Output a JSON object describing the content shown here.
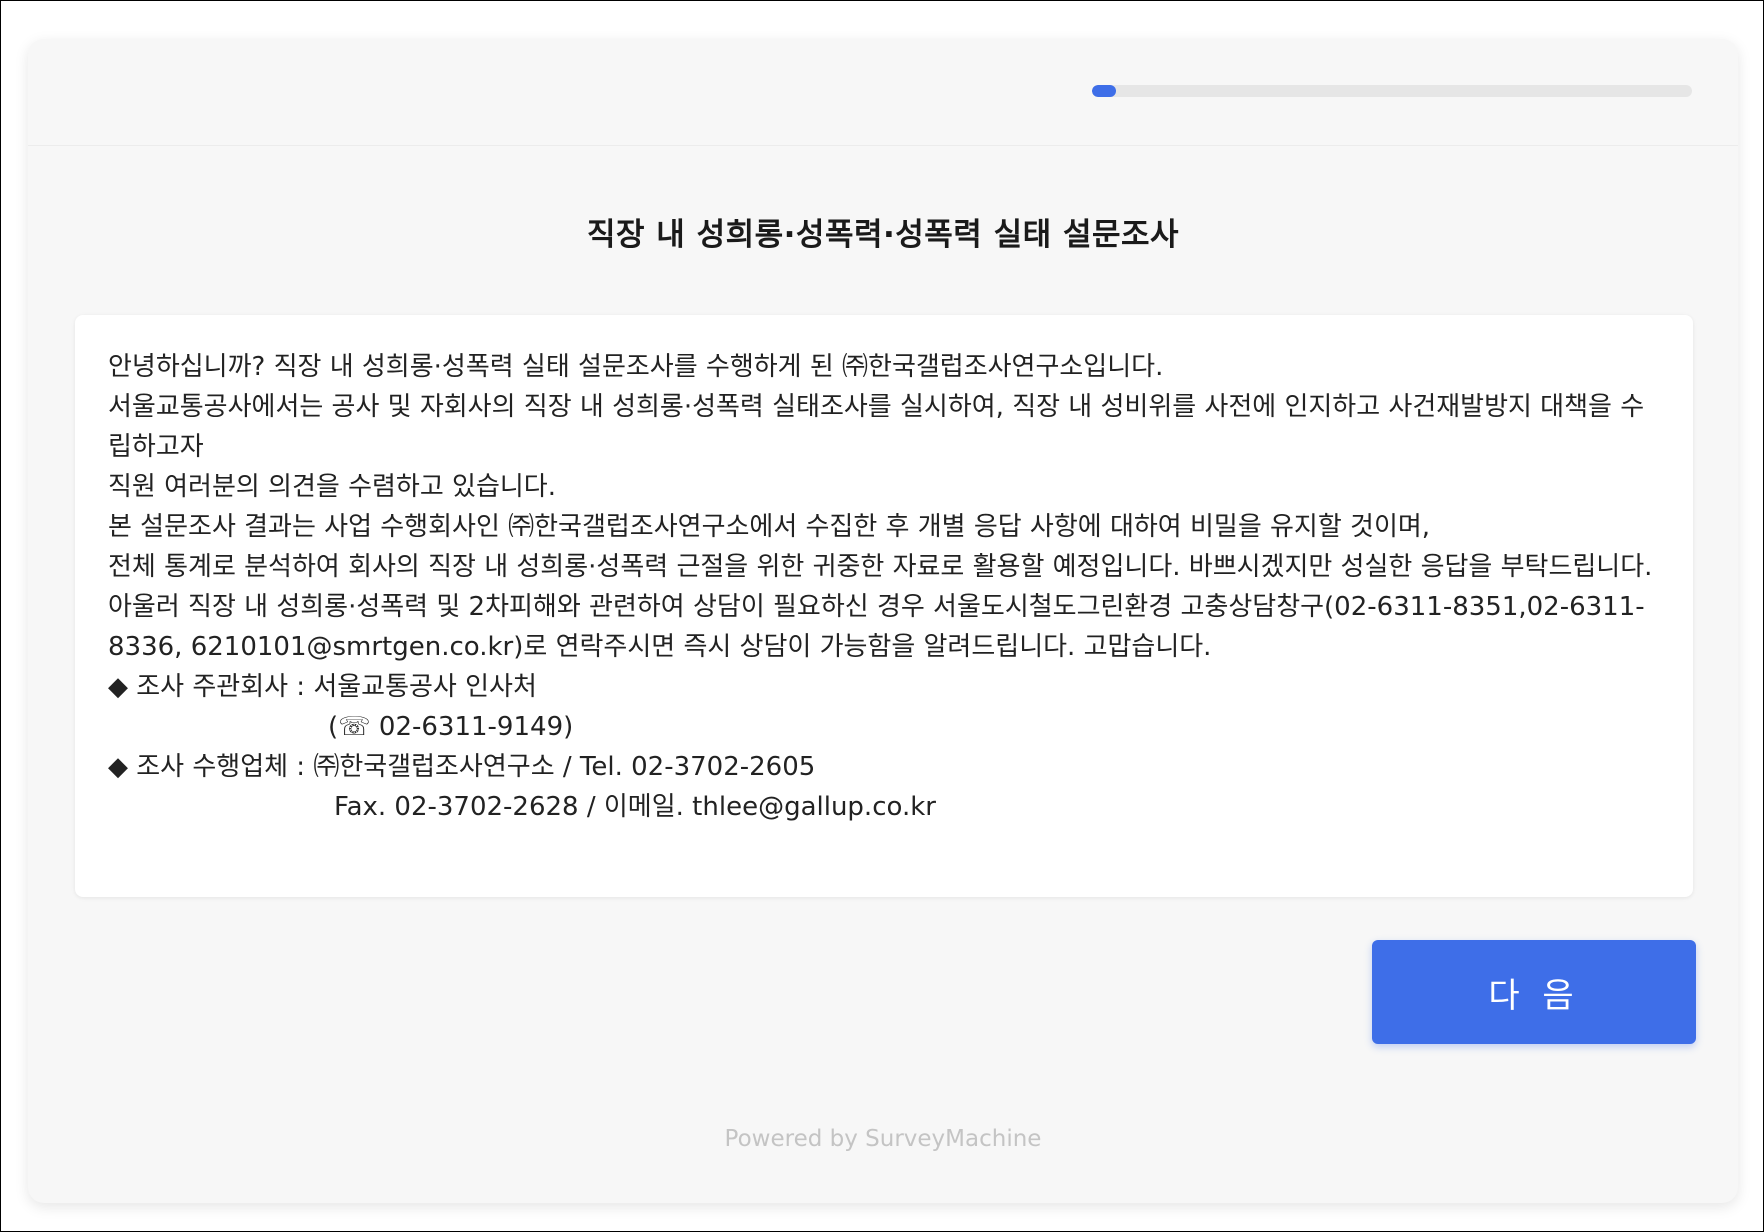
{
  "progress": {
    "fraction": 0.04
  },
  "survey": {
    "title": "직장 내 성희롱·성폭력·성폭력 실태 설문조사"
  },
  "intro": {
    "line1": "안녕하십니까? 직장 내 성희롱·성폭력 실태 설문조사를 수행하게 된 ㈜한국갤럽조사연구소입니다.",
    "line2": "서울교통공사에서는 공사 및 자회사의 직장 내 성희롱·성폭력 실태조사를 실시하여, 직장 내 성비위를 사전에 인지하고 사건재발방지 대책을 수립하고자",
    "line3": "직원 여러분의 의견을 수렴하고 있습니다.",
    "line4": "본 설문조사 결과는 사업 수행회사인 ㈜한국갤럽조사연구소에서 수집한 후 개별 응답 사항에 대하여 비밀을 유지할 것이며,",
    "line5": "전체 통계로 분석하여 회사의 직장 내 성희롱·성폭력 근절을 위한 귀중한 자료로 활용할 예정입니다. 바쁘시겠지만 성실한 응답을 부탁드립니다.",
    "line6": "아울러 직장 내 성희롱·성폭력 및 2차피해와 관련하여 상담이 필요하신 경우 서울도시철도그린환경 고충상담창구(02-6311-8351,02-6311-8336, 6210101@smrtgen.co.kr)로 연락주시면 즉시 상담이 가능함을 알려드립니다. 고맙습니다.",
    "organizer": "◆ 조사 주관회사 : 서울교통공사 인사처",
    "organizer_phone": "(☏ 02-6311-9149)",
    "contractor": "◆ 조사 수행업체 : ㈜한국갤럽조사연구소 / Tel. 02-3702-2605",
    "contractor_contact": "Fax. 02-3702-2628 / 이메일. thlee@gallup.co.kr"
  },
  "buttons": {
    "next_label": "다 음"
  },
  "footer": {
    "powered_by": "Powered by SurveyMachine"
  },
  "colors": {
    "accent": "#3e6ee8",
    "background": "#f7f7f7",
    "panel": "#ffffff"
  }
}
